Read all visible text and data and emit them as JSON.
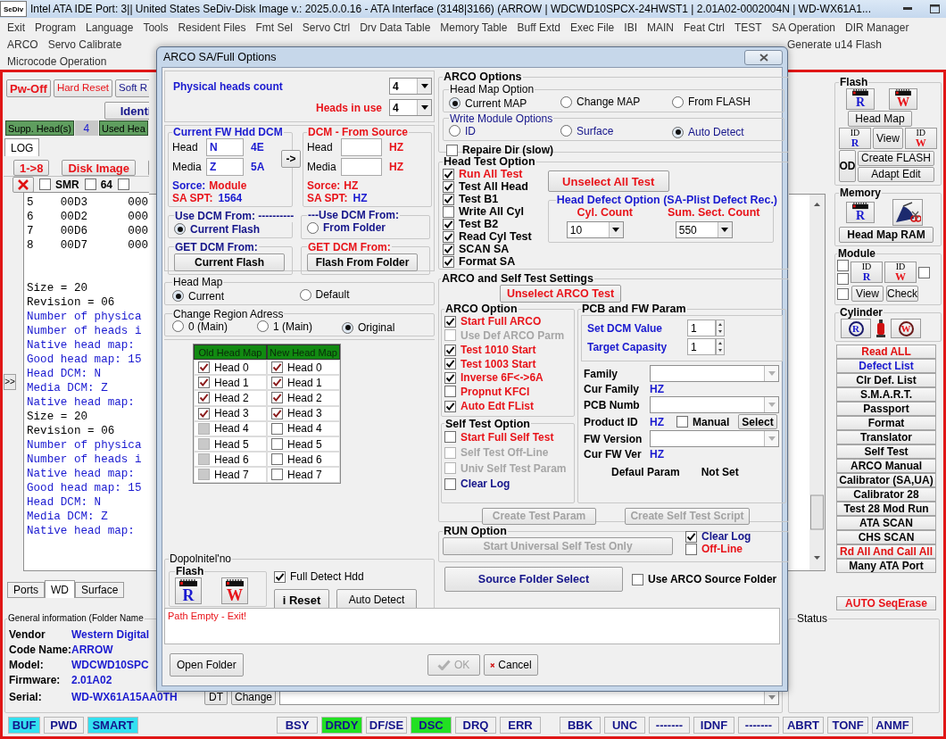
{
  "window": {
    "app_icon": "SeDiv",
    "title": "Intel ATA IDE  Port: 3|| United States  SeDiv-Disk Image v.: 2025.0.0.16 - ATA Interface (3148|3166)  (ARROW | WDCWD10SPCX-24HWST1 | 2.01A02-0002004N | WD-WX61A1..."
  },
  "menu": {
    "rows": [
      {
        "items": [
          "Exit",
          "Program",
          "Language",
          "Tools",
          "Resident Files",
          "Fmt Sel",
          "Servo Ctrl",
          "Drv Data Table",
          "Memory Table",
          "Buff Extd",
          "Exec File",
          "IBI",
          "MAIN",
          "Feat Ctrl",
          "TEST",
          "SA Operation",
          "DIR Manager"
        ]
      },
      {
        "items": [
          "ARCO",
          "Servo Calibrate",
          "Generate u14 Flash"
        ]
      },
      {
        "items": [
          "Microcode Operation"
        ]
      }
    ]
  },
  "left_panel": {
    "power_buttons": [
      {
        "label": "Pw-Off",
        "kind": "power"
      },
      {
        "label": "Hard Reset",
        "kind": "reset"
      },
      {
        "label": "Soft R",
        "kind": "soft"
      }
    ],
    "identify_button": "Identi",
    "supp_heads": {
      "label": "Supp. Head(s)",
      "value": "4",
      "used_label": "Used Hea"
    },
    "tabs": [
      {
        "label": "LOG",
        "selected": true
      }
    ],
    "action_buttons": [
      "1->8",
      "Disk Image"
    ],
    "options": [
      {
        "label": "SMR",
        "checked": false
      },
      {
        "label": "64",
        "checked": false
      },
      {
        "checked": false
      }
    ],
    "expand_button": ">>",
    "log_table": [
      {
        "text": "5    00D3      000"
      },
      {
        "text": "6    00D2      000"
      },
      {
        "text": "7    00D6      000"
      },
      {
        "text": "8    00D7      000"
      }
    ],
    "log": [
      {
        "text": "Size = 20",
        "color": "#000000"
      },
      {
        "text": "Revision = 06",
        "color": "#000000"
      },
      {
        "text": "Number of physica",
        "color": "#1a1ad0"
      },
      {
        "text": "Number of heads i",
        "color": "#1a1ad0"
      },
      {
        "text": "Native head map:",
        "color": "#1a1ad0"
      },
      {
        "text": "Good head map: 15",
        "color": "#1a1ad0"
      },
      {
        "text": "Head DCM: N",
        "color": "#1a1ad0"
      },
      {
        "text": "Media DCM: Z",
        "color": "#1a1ad0"
      },
      {
        "text": "Native head map:",
        "color": "#1a1ad0"
      },
      {
        "text": "Size = 20",
        "color": "#000000"
      },
      {
        "text": "Revision = 06",
        "color": "#000000"
      },
      {
        "text": "Number of physica",
        "color": "#1a1ad0"
      },
      {
        "text": "Number of heads i",
        "color": "#1a1ad0"
      },
      {
        "text": "Native head map:",
        "color": "#1a1ad0"
      },
      {
        "text": "Good head map: 15",
        "color": "#1a1ad0"
      },
      {
        "text": "Head DCM: N",
        "color": "#1a1ad0"
      },
      {
        "text": "Media DCM: Z",
        "color": "#1a1ad0"
      },
      {
        "text": "Native head map:",
        "color": "#1a1ad0"
      }
    ]
  },
  "right_panel": {
    "flash": {
      "title": "Flash",
      "read": "R",
      "write": "W",
      "head_map": "Head Map",
      "id_read": {
        "id": "ID",
        "letter": "R"
      },
      "view": "View",
      "id_write": {
        "id": "ID",
        "letter": "W"
      },
      "od": "OD",
      "create": "Create FLASH",
      "adapt": "Adapt Edit"
    },
    "memory": {
      "title": "Memory",
      "read": "R",
      "head_map": "Head Map RAM"
    },
    "module": {
      "title": "Module",
      "id_read": {
        "id": "ID",
        "letter": "R"
      },
      "id_write": {
        "id": "ID",
        "letter": "W"
      },
      "view": "View",
      "check": "Check",
      "checks": [
        {
          "checked": false
        },
        {
          "checked": false
        },
        {
          "checked": false
        },
        {
          "checked": false
        }
      ]
    },
    "cylinder": {
      "title": "Cylinder",
      "read": "R",
      "write": "W"
    },
    "commands": [
      {
        "label": "Read ALL",
        "color": "#e01010"
      },
      {
        "label": "Defect List",
        "color": "#1a1ad0"
      },
      {
        "label": "Clr Def. List",
        "color": "#000000"
      },
      {
        "label": "S.M.A.R.T.",
        "color": "#000000"
      },
      {
        "label": "Passport",
        "color": "#000000"
      },
      {
        "label": "Format",
        "color": "#000000"
      },
      {
        "label": "Translator",
        "color": "#000000"
      },
      {
        "label": "Self Test",
        "color": "#000000"
      },
      {
        "label": "ARCO Manual",
        "color": "#000000"
      },
      {
        "label": "Calibrator (SA,UA)",
        "color": "#000000"
      },
      {
        "label": "Calibrator 28",
        "color": "#000000"
      },
      {
        "label": "Test 28 Mod Run",
        "color": "#000000"
      },
      {
        "label": "ATA SCAN",
        "color": "#000000"
      },
      {
        "label": "CHS SCAN",
        "color": "#000000"
      },
      {
        "label": "Rd All And Call All",
        "color": "#e01010"
      },
      {
        "label": "Many ATA Port",
        "color": "#000000"
      }
    ],
    "auto_button": "AUTO SeqErase"
  },
  "bottom": {
    "tabs": [
      {
        "label": "Ports",
        "selected": false
      },
      {
        "label": "WD",
        "selected": true
      },
      {
        "label": "Surface",
        "selected": false
      }
    ],
    "general_info": {
      "title": "General information (Folder Name",
      "rows": [
        {
          "label": "Vendor",
          "value": "Western Digital"
        },
        {
          "label": "Code Name:",
          "value": "ARROW"
        },
        {
          "label": "Model:",
          "value": "WDCWD10SPC"
        },
        {
          "label": "Firmware:",
          "value": "2.01A02"
        },
        {
          "label": "Serial:",
          "value": "WD-WX61A15AA0TH"
        }
      ],
      "dt_button": "DT",
      "change_button": "Change"
    },
    "status_group": {
      "title": "Status"
    }
  },
  "status_bar": {
    "modes": [
      {
        "label": "BUF",
        "on": true
      },
      {
        "label": "PWD",
        "on": false
      },
      {
        "label": "SMART",
        "on": true
      }
    ],
    "registers": [
      {
        "label": "BSY",
        "on": false
      },
      {
        "label": "DRDY",
        "on": true
      },
      {
        "label": "DF/SE",
        "on": false
      },
      {
        "label": "DSC",
        "on": true
      },
      {
        "label": "DRQ",
        "on": false
      },
      {
        "label": "ERR",
        "on": false
      }
    ],
    "errors": [
      {
        "label": "BBK",
        "on": false
      },
      {
        "label": "UNC",
        "on": false
      },
      {
        "label": "-------",
        "on": false
      },
      {
        "label": "IDNF",
        "on": false
      },
      {
        "label": "-------",
        "on": false
      },
      {
        "label": "ABRT",
        "on": false
      },
      {
        "label": "TONF",
        "on": false
      },
      {
        "label": "ANMF",
        "on": false
      }
    ]
  },
  "dialog": {
    "title": "ARCO SA/Full Options",
    "heads": {
      "physical_label": "Physical heads count",
      "physical_value": "4",
      "in_use_label": "Heads in use",
      "in_use_value": "4"
    },
    "current_dcm": {
      "title": "Current FW Hdd DCM",
      "head_label": "Head",
      "head_value": "N",
      "head_hex": "4E",
      "media_label": "Media",
      "media_value": "Z",
      "media_hex": "5A",
      "source_label": "Sorce:",
      "source_value": "Module",
      "spt_label": "SA SPT:",
      "spt_value": "1564"
    },
    "copy_button": "->",
    "source_dcm": {
      "title": "DCM - From Source",
      "head_label": "Head",
      "head_hex": "HZ",
      "media_label": "Media",
      "media_hex": "HZ",
      "source_label": "Sorce:",
      "source_value": "HZ",
      "spt_label": "SA SPT:",
      "spt_value": "HZ"
    },
    "use_dcm": [
      {
        "title": "Use DCM From: ----------",
        "option": "Current Flash",
        "selected": true
      },
      {
        "title": "---Use DCM From:",
        "option": "From Folder",
        "selected": false
      }
    ],
    "get_dcm": [
      {
        "title": "GET DCM From:",
        "button": "Current Flash"
      },
      {
        "title": "GET DCM From:",
        "button": "Flash From Folder"
      }
    ],
    "head_map": {
      "title": "Head Map",
      "options": [
        {
          "label": "Current",
          "selected": true
        },
        {
          "label": "Default",
          "selected": false
        }
      ]
    },
    "region": {
      "title": "Change Region Adress",
      "options": [
        {
          "label": "0 (Main)",
          "selected": false
        },
        {
          "label": "1 (Main)",
          "selected": false
        },
        {
          "label": "Original",
          "selected": true
        }
      ]
    },
    "head_table": {
      "columns": [
        "Old Head Map",
        "New Head Map"
      ],
      "rows": [
        {
          "old": {
            "label": "Head 0",
            "checked": true,
            "disabled": false
          },
          "new": {
            "label": "Head 0",
            "checked": true
          }
        },
        {
          "old": {
            "label": "Head 1",
            "checked": true,
            "disabled": false
          },
          "new": {
            "label": "Head 1",
            "checked": true
          }
        },
        {
          "old": {
            "label": "Head 2",
            "checked": true,
            "disabled": false
          },
          "new": {
            "label": "Head 2",
            "checked": true
          }
        },
        {
          "old": {
            "label": "Head 3",
            "checked": true,
            "disabled": false
          },
          "new": {
            "label": "Head 3",
            "checked": true
          }
        },
        {
          "old": {
            "label": "Head 4",
            "checked": false,
            "disabled": true
          },
          "new": {
            "label": "Head 4",
            "checked": false
          }
        },
        {
          "old": {
            "label": "Head 5",
            "checked": false,
            "disabled": true
          },
          "new": {
            "label": "Head 5",
            "checked": false
          }
        },
        {
          "old": {
            "label": "Head 6",
            "checked": false,
            "disabled": true
          },
          "new": {
            "label": "Head 6",
            "checked": false
          }
        },
        {
          "old": {
            "label": "Head 7",
            "checked": false,
            "disabled": true
          },
          "new": {
            "label": "Head 7",
            "checked": false
          }
        }
      ]
    },
    "extra": {
      "title": "Dopolnitel'no",
      "flash_title": "Flash",
      "read": "R",
      "write": "W",
      "full_detect": {
        "label": "Full Detect Hdd",
        "checked": true
      },
      "reset_button": "i Reset",
      "auto_button": "Auto Detect"
    },
    "arco_options": {
      "title": "ARCO Options",
      "head_map_option": {
        "title": "Head Map Option",
        "options": [
          {
            "label": "Current MAP",
            "selected": true
          },
          {
            "label": "Change MAP",
            "selected": false
          },
          {
            "label": "From FLASH",
            "selected": false
          }
        ]
      },
      "write_module": {
        "title": "Write Module Options",
        "options": [
          {
            "label": "ID",
            "selected": false
          },
          {
            "label": "Surface",
            "selected": false
          },
          {
            "label": "Auto Detect",
            "selected": true
          }
        ]
      },
      "repair_dir": {
        "label": "Repaire Dir (slow)",
        "checked": false
      }
    },
    "head_test": {
      "title": "Head Test Option",
      "items": [
        {
          "label": "Run All Test",
          "checked": true,
          "color": "#e8141a"
        },
        {
          "label": "Test All Head",
          "checked": true,
          "color": "#000000"
        },
        {
          "label": "Test B1",
          "checked": true,
          "color": "#000000"
        },
        {
          "label": "Write All Cyl",
          "checked": false,
          "color": "#000000"
        },
        {
          "label": "Test B2",
          "checked": true,
          "color": "#000000"
        },
        {
          "label": "Read Cyl Test",
          "checked": true,
          "color": "#000000"
        },
        {
          "label": "SCAN SA",
          "checked": true,
          "color": "#000000"
        },
        {
          "label": "Format SA",
          "checked": true,
          "color": "#000000"
        }
      ],
      "unselect_button": "Unselect All Test",
      "defect": {
        "title": "Head Defect Option (SA-Plist Defect Rec.)",
        "cyl_label": "Cyl. Count",
        "cyl_value": "10",
        "sect_label": "Sum. Sect. Count",
        "sect_value": "550"
      }
    },
    "settings": {
      "title": "ARCO and Self Test Settings",
      "unselect_button": "Unselect ARCO Test",
      "arco": {
        "title": "ARCO Option",
        "items": [
          {
            "label": "Start Full ARCO",
            "checked": true,
            "disabled": false,
            "color": "#e8141a"
          },
          {
            "label": "Use Def ARCO Parm",
            "checked": false,
            "disabled": true
          },
          {
            "label": "Test 1010 Start",
            "checked": true,
            "disabled": false,
            "color": "#e8141a"
          },
          {
            "label": "Test 1003 Start",
            "checked": true,
            "disabled": false,
            "color": "#e8141a"
          },
          {
            "label": "Inverse 6F<->6A",
            "checked": true,
            "disabled": false,
            "color": "#e8141a"
          },
          {
            "label": "Propnut KFCI",
            "checked": false,
            "disabled": false,
            "color": "#e8141a"
          },
          {
            "label": "Auto Edt FList",
            "checked": true,
            "disabled": false,
            "color": "#e8141a"
          }
        ]
      },
      "self_test": {
        "title": "Self Test Option",
        "items": [
          {
            "label": "Start Full Self Test",
            "checked": false,
            "disabled": false,
            "color": "#e8141a"
          },
          {
            "label": "Self Test Off-Line",
            "checked": false,
            "disabled": true
          },
          {
            "label": "Univ Self Test Param",
            "checked": false,
            "disabled": true
          },
          {
            "label": "Clear Log",
            "checked": false,
            "disabled": false,
            "color": "#14148a"
          }
        ]
      },
      "pcb": {
        "title": "PCB and FW Param",
        "dcm_label": "Set DCM Value",
        "dcm_value": "1",
        "capacity_label": "Target Capasity",
        "capacity_value": "1",
        "family_label": "Family",
        "cur_family_label": "Cur Family",
        "cur_family_value": "HZ",
        "pcb_label": "PCB Numb",
        "product_label": "Product ID",
        "product_value": "HZ",
        "manual": {
          "label": "Manual",
          "checked": false
        },
        "select_button": "Select",
        "fw_label": "FW Version",
        "cur_fw_label": "Cur FW Ver",
        "cur_fw_value": "HZ",
        "default_label": "Defaul Param",
        "default_value": "Not Set"
      },
      "create_buttons": [
        {
          "label": "Create Test Param",
          "disabled": true
        },
        {
          "label": "Create Self Test Script",
          "disabled": true
        }
      ]
    },
    "run": {
      "title": "RUN Option",
      "start_button": {
        "label": "Start Universal Self Test Only",
        "disabled": true
      },
      "items": [
        {
          "label": "Clear Log",
          "checked": true,
          "color": "#14148a"
        },
        {
          "label": "Off-Line",
          "checked": false,
          "color": "#e8141a"
        }
      ]
    },
    "source_button": "Source Folder Select",
    "use_source": {
      "label": "Use ARCO Source Folder",
      "checked": false
    },
    "message": "Path Empty - Exit!",
    "open_folder": "Open Folder",
    "ok_button": {
      "label": "OK",
      "disabled": true
    },
    "cancel_button": "Cancel"
  }
}
